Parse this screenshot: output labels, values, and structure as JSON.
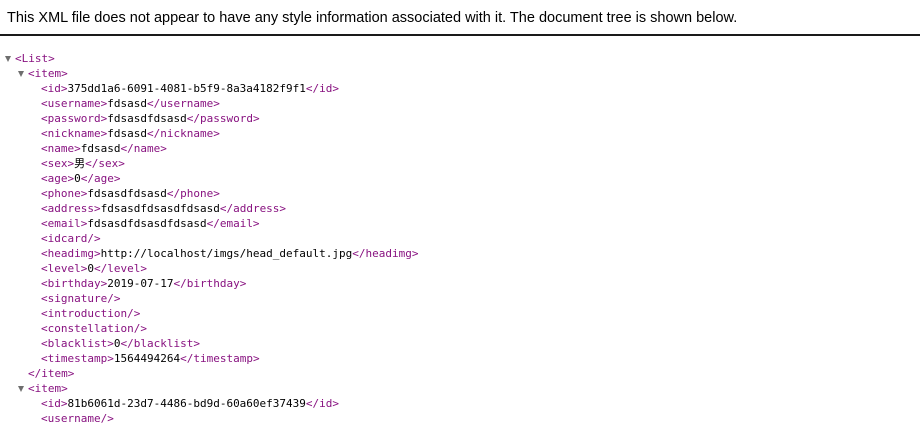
{
  "banner": "This XML file does not appear to have any style information associated with it. The document tree is shown below.",
  "tree": [
    {
      "indent": 0,
      "toggle": true,
      "tag": "<List>"
    },
    {
      "indent": 1,
      "toggle": true,
      "tag": "<item>"
    },
    {
      "indent": 2,
      "open": "<id>",
      "text": "375dd1a6-6091-4081-b5f9-8a3a4182f9f1",
      "close": "</id>"
    },
    {
      "indent": 2,
      "open": "<username>",
      "text": "fdsasd",
      "close": "</username>"
    },
    {
      "indent": 2,
      "open": "<password>",
      "text": "fdsasdfdsasd",
      "close": "</password>"
    },
    {
      "indent": 2,
      "open": "<nickname>",
      "text": "fdsasd",
      "close": "</nickname>"
    },
    {
      "indent": 2,
      "open": "<name>",
      "text": "fdsasd",
      "close": "</name>"
    },
    {
      "indent": 2,
      "open": "<sex>",
      "text": "男",
      "close": "</sex>"
    },
    {
      "indent": 2,
      "open": "<age>",
      "text": "0",
      "close": "</age>"
    },
    {
      "indent": 2,
      "open": "<phone>",
      "text": "fdsasdfdsasd",
      "close": "</phone>"
    },
    {
      "indent": 2,
      "open": "<address>",
      "text": "fdsasdfdsasdfdsasd",
      "close": "</address>"
    },
    {
      "indent": 2,
      "open": "<email>",
      "text": "fdsasdfdsasdfdsasd",
      "close": "</email>"
    },
    {
      "indent": 2,
      "tag": "<idcard/>"
    },
    {
      "indent": 2,
      "open": "<headimg>",
      "text": "http://localhost/imgs/head_default.jpg",
      "close": "</headimg>"
    },
    {
      "indent": 2,
      "open": "<level>",
      "text": "0",
      "close": "</level>"
    },
    {
      "indent": 2,
      "open": "<birthday>",
      "text": "2019-07-17",
      "close": "</birthday>"
    },
    {
      "indent": 2,
      "tag": "<signature/>"
    },
    {
      "indent": 2,
      "tag": "<introduction/>"
    },
    {
      "indent": 2,
      "tag": "<constellation/>"
    },
    {
      "indent": 2,
      "open": "<blacklist>",
      "text": "0",
      "close": "</blacklist>"
    },
    {
      "indent": 2,
      "open": "<timestamp>",
      "text": "1564494264",
      "close": "</timestamp>"
    },
    {
      "indent": 1,
      "tag": "</item>"
    },
    {
      "indent": 1,
      "toggle": true,
      "tag": "<item>"
    },
    {
      "indent": 2,
      "open": "<id>",
      "text": "81b6061d-23d7-4486-bd9d-60a60ef37439",
      "close": "</id>"
    },
    {
      "indent": 2,
      "tag": "<username/>"
    }
  ],
  "colors": {
    "tag": "#881280",
    "text": "#000000",
    "toggle": "#6e6e6e"
  },
  "icons": {
    "toggle": "triangle-down-icon"
  }
}
